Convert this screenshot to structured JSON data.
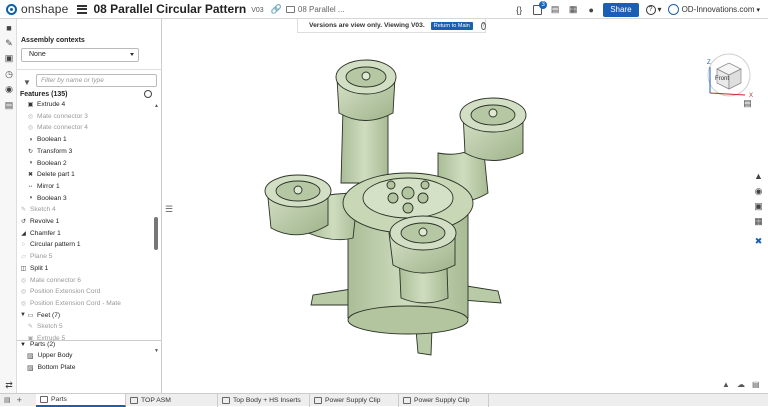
{
  "app": {
    "logo_text": "onshape",
    "doc_title": "08 Parallel Circular Pattern",
    "version_tag": "V03",
    "folder_label": "08 Parallel ..."
  },
  "topbar": {
    "notification_count": "3",
    "share_label": "Share",
    "user_name": "OD-Innovations.com"
  },
  "banner": {
    "text": "Versions are view only. Viewing V03.",
    "button": "Return to Main"
  },
  "panel": {
    "assembly_contexts_label": "Assembly contexts",
    "assembly_contexts_value": "None",
    "filter_placeholder": "Filter by name or type",
    "features_header": "Features (135)",
    "features": [
      {
        "label": "Extrude 4",
        "state": "active",
        "icon": "extrude-icon"
      },
      {
        "label": "Mate connector 3",
        "state": "suppressed",
        "icon": "mate-connector-icon"
      },
      {
        "label": "Mate connector 4",
        "state": "suppressed",
        "icon": "mate-connector-icon"
      },
      {
        "label": "Boolean 1",
        "state": "active",
        "icon": "boolean-icon"
      },
      {
        "label": "Transform 3",
        "state": "active",
        "icon": "transform-icon"
      },
      {
        "label": "Boolean 2",
        "state": "active",
        "icon": "boolean-icon"
      },
      {
        "label": "Delete part 1",
        "state": "active",
        "icon": "delete-part-icon"
      },
      {
        "label": "Mirror 1",
        "state": "active",
        "icon": "mirror-icon"
      },
      {
        "label": "Boolean 3",
        "state": "active",
        "icon": "boolean-icon"
      },
      {
        "label": "Sketch 4",
        "state": "suppressed",
        "icon": "sketch-icon"
      },
      {
        "label": "Revolve 1",
        "state": "active",
        "icon": "revolve-icon"
      },
      {
        "label": "Chamfer 1",
        "state": "active",
        "icon": "chamfer-icon"
      },
      {
        "label": "Circular pattern 1",
        "state": "active",
        "icon": "circular-pattern-icon"
      },
      {
        "label": "Plane 5",
        "state": "suppressed",
        "icon": "plane-icon"
      },
      {
        "label": "Split 1",
        "state": "active",
        "icon": "split-icon"
      },
      {
        "label": "Mate connector 6",
        "state": "suppressed",
        "icon": "mate-connector-icon"
      },
      {
        "label": "Position Extension Cord",
        "state": "suppressed",
        "icon": "mate-connector-icon"
      },
      {
        "label": "Position Extension Cord - Mate",
        "state": "suppressed",
        "icon": "mate-connector-icon"
      },
      {
        "label": "Feet (7)",
        "state": "folder",
        "icon": "folder-icon"
      },
      {
        "label": "Sketch 5",
        "state": "suppressed",
        "icon": "sketch-icon"
      },
      {
        "label": "Extrude 5",
        "state": "suppressed",
        "icon": "extrude-icon"
      }
    ],
    "parts_header": "Parts (2)",
    "parts": [
      "Upper Body",
      "Bottom Plate"
    ]
  },
  "viewcube": {
    "front_label": "Front",
    "axis_z": "Z",
    "axis_x": "X"
  },
  "tabs": [
    {
      "label": "Parts",
      "active": true
    },
    {
      "label": "TOP ASM",
      "active": false
    },
    {
      "label": "Top Body + HS Inserts",
      "active": false
    },
    {
      "label": "Power Supply Clip",
      "active": false
    },
    {
      "label": "Power Supply Clip",
      "active": false
    }
  ],
  "colors": {
    "accent": "#1a5fb4",
    "model_fill": "#c3d4b2",
    "model_edge": "#2b3326"
  }
}
